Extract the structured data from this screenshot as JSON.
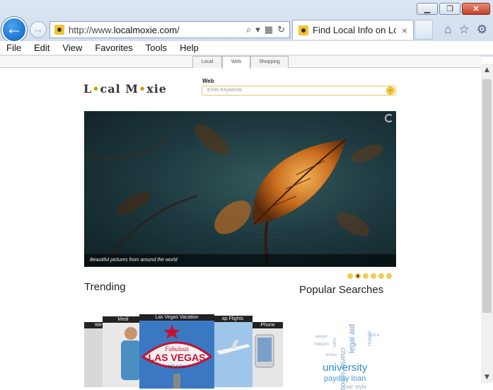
{
  "window": {
    "controls": [
      "minimize",
      "restore",
      "close"
    ]
  },
  "addressbar": {
    "url_prefix": "http://www.",
    "url_domain": "localmoxie.com",
    "url_suffix": "/"
  },
  "tab": {
    "title": "Find Local Info on Lo...",
    "close_label": "×"
  },
  "menu": [
    "File",
    "Edit",
    "View",
    "Favorites",
    "Tools",
    "Help"
  ],
  "subtabs": [
    "Local",
    "Web",
    "Shopping"
  ],
  "site": {
    "logo_text": "Local Moxie",
    "search_label": "Web",
    "search_placeholder": "Enter Keywords",
    "hero_caption": "Beautiful pictures from around the world",
    "trending_heading": "Trending",
    "popular_heading": "Popular Searches"
  },
  "carousel": {
    "dots": 6,
    "active_dot": 1
  },
  "trending_cards": [
    {
      "label": "We"
    },
    {
      "label": "Medi"
    },
    {
      "label": "Las Vegas Vacation"
    },
    {
      "label": "ap Flights"
    },
    {
      "label": "Phone"
    }
  ],
  "popular_words": [
    "charter schools",
    "legal aid",
    "movie",
    "lawyer",
    "mason",
    "university",
    "payday loan",
    "hair style",
    "pizza",
    "cars",
    "shoes"
  ],
  "colors": {
    "accent": "#f1cc55",
    "link_blue": "#2f8fd0"
  }
}
